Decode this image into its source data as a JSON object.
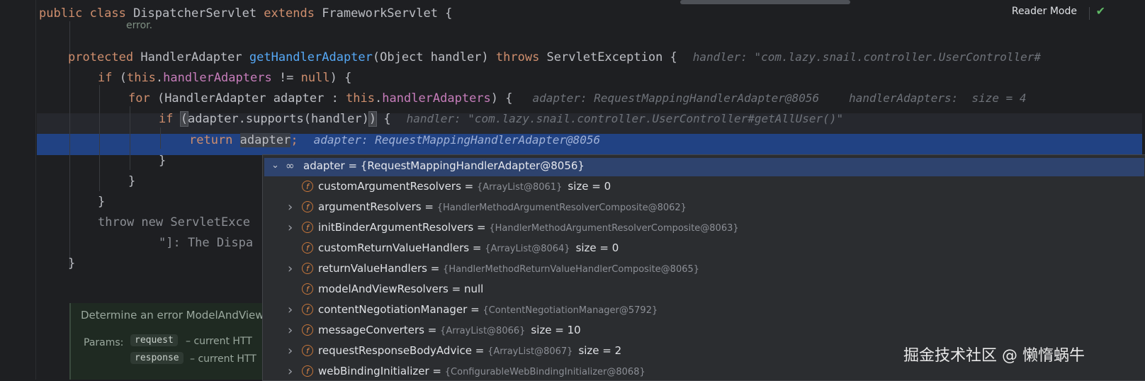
{
  "editor": {
    "error_fragment": "error.",
    "lines": {
      "l1": {
        "kw1": "public class ",
        "cls": "DispatcherServlet ",
        "kw2": "extends ",
        "cls2": "FrameworkServlet {"
      },
      "l2": {
        "kw": "protected ",
        "type": "HandlerAdapter ",
        "fn": "getHandlerAdapter",
        "args": "(Object handler) ",
        "kw2": "throws ",
        "rest": "ServletException {",
        "hint": "handler: \"com.lazy.snail.controller.UserController#"
      },
      "l3": {
        "kw": "if ",
        "a": "(",
        "this": "this",
        "dot": ".",
        "field": "handlerAdapters",
        "rest": " != ",
        "null": "null",
        ") {": ") {"
      },
      "l4": {
        "kw": "for ",
        "a": "(HandlerAdapter adapter : ",
        "this": "this",
        "dot": ".",
        "field": "handlerAdapters",
        "rest": ") {",
        "hint1": "adapter: RequestMappingHandlerAdapter@8056",
        "hint2": "handlerAdapters:  size = 4"
      },
      "l5": {
        "kw": "if ",
        "a": "(",
        "b": "adapter.supports(handler)",
        "c": ")",
        "rest": " {",
        "hint": "handler: \"com.lazy.snail.controller.UserController#getAllUser()\""
      },
      "l6": {
        "kw": "return ",
        "var": "adapter",
        ";": ";",
        "hint": "adapter: RequestMappingHandlerAdapter@8056"
      },
      "l7": "}",
      "l8": "}",
      "l9": "}",
      "l10": {
        "kw": "throw new ",
        "rest": "ServletExce"
      },
      "l11": {
        "str": "\"]: The Dispa"
      },
      "l12": "}"
    }
  },
  "reader_mode_label": "Reader Mode",
  "doc": {
    "title": "Determine an error ModelAndView",
    "params_label": "Params:",
    "p1_name": "request",
    "p1_text": "– current HTT",
    "p2_name": "response",
    "p2_text": "– current HTT"
  },
  "debug_popup": {
    "root": {
      "icon": "glasses-icon",
      "label": "adapter = {RequestMappingHandlerAdapter@8056}"
    },
    "fields": [
      {
        "name": "customArgumentResolvers",
        "eq": " = ",
        "val": "{ArrayList@8061}",
        "size": "size = 0",
        "expandable": false
      },
      {
        "name": "argumentResolvers",
        "eq": " = ",
        "val": "{HandlerMethodArgumentResolverComposite@8062}",
        "size": "",
        "expandable": true
      },
      {
        "name": "initBinderArgumentResolvers",
        "eq": " = ",
        "val": "{HandlerMethodArgumentResolverComposite@8063}",
        "size": "",
        "expandable": true
      },
      {
        "name": "customReturnValueHandlers",
        "eq": " = ",
        "val": "{ArrayList@8064}",
        "size": "size = 0",
        "expandable": false
      },
      {
        "name": "returnValueHandlers",
        "eq": " = ",
        "val": "{HandlerMethodReturnValueHandlerComposite@8065}",
        "size": "",
        "expandable": true
      },
      {
        "name": "modelAndViewResolvers",
        "eq": " = ",
        "val": "null",
        "size": "",
        "expandable": false
      },
      {
        "name": "contentNegotiationManager",
        "eq": " = ",
        "val": "{ContentNegotiationManager@5792}",
        "size": "",
        "expandable": true
      },
      {
        "name": "messageConverters",
        "eq": " = ",
        "val": "{ArrayList@8066}",
        "size": "size = 10",
        "expandable": true
      },
      {
        "name": "requestResponseBodyAdvice",
        "eq": " = ",
        "val": "{ArrayList@8067}",
        "size": "size = 2",
        "expandable": true
      },
      {
        "name": "webBindingInitializer",
        "eq": " = ",
        "val": "{ConfigurableWebBindingInitializer@8068}",
        "size": "",
        "expandable": true
      }
    ]
  },
  "watermark": "掘金技术社区 @ 懒惰蜗牛"
}
